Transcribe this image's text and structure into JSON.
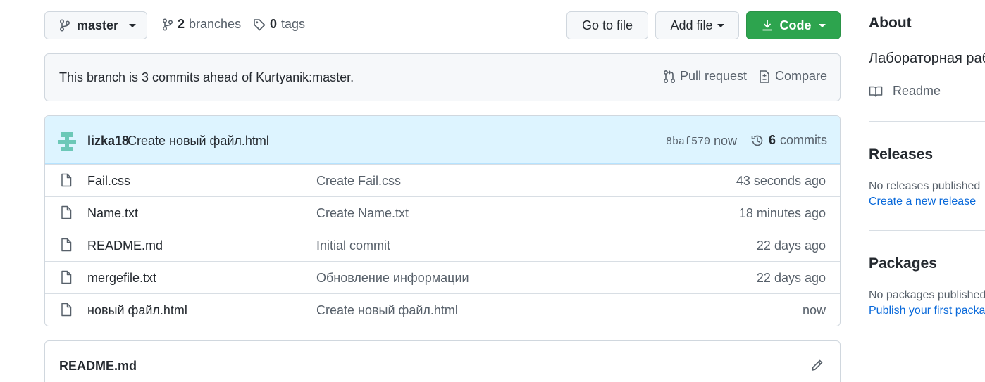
{
  "top_bar": {
    "branch_name": "master",
    "branches_count": "2",
    "branches_label": "branches",
    "tags_count": "0",
    "tags_label": "tags",
    "go_to_file": "Go to file",
    "add_file": "Add file",
    "code": "Code"
  },
  "ahead": {
    "message": "This branch is 3 commits ahead of Kurtyanik:master.",
    "pull_request": "Pull request",
    "compare": "Compare"
  },
  "latest_commit": {
    "author": "lizka18",
    "message": "Create новый файл.html",
    "sha": "8baf570",
    "time": "now",
    "commit_count": "6",
    "commits_label": "commits"
  },
  "files": [
    {
      "name": "Fail.css",
      "message": "Create Fail.css",
      "age": "43 seconds ago",
      "icon": "file-icon"
    },
    {
      "name": "Name.txt",
      "message": "Create Name.txt",
      "age": "18 minutes ago",
      "icon": "file-icon"
    },
    {
      "name": "README.md",
      "message": "Initial commit",
      "age": "22 days ago",
      "icon": "file-icon"
    },
    {
      "name": "mergefile.txt",
      "message": "Обновление информации",
      "age": "22 days ago",
      "icon": "file-icon"
    },
    {
      "name": "новый файл.html",
      "message": "Create новый файл.html",
      "age": "now",
      "icon": "file-icon"
    }
  ],
  "readme": {
    "title": "README.md"
  },
  "sidebar": {
    "about_title": "About",
    "description": "Лабораторная работа",
    "readme_link": "Readme",
    "releases_title": "Releases",
    "releases_empty": "No releases published",
    "releases_create": "Create a new release",
    "packages_title": "Packages",
    "packages_empty": "No packages published",
    "packages_publish": "Publish your first package"
  },
  "colors": {
    "code_button": "#2da44e",
    "link": "#0969da",
    "commit_header_bg": "#ddf4ff"
  }
}
